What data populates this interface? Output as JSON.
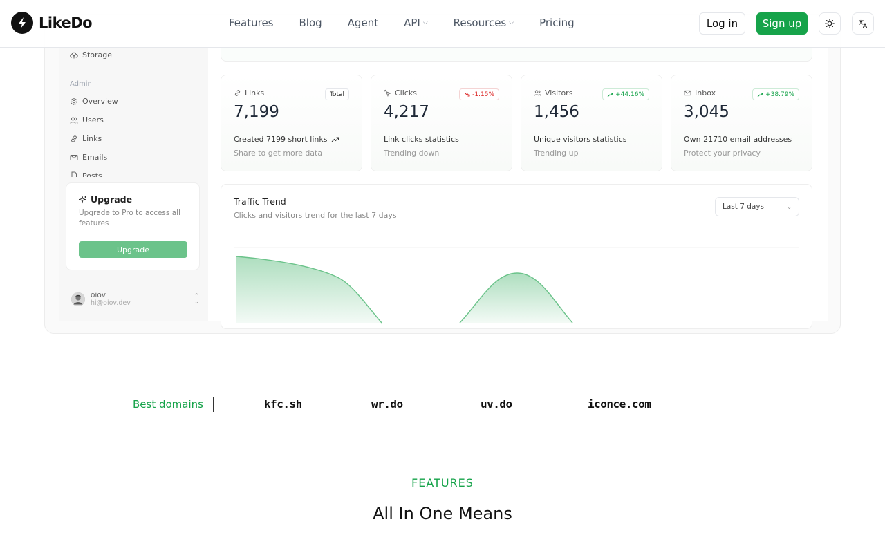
{
  "brand": {
    "name": "LikeDo"
  },
  "nav": {
    "items": [
      {
        "label": "Features",
        "dropdown": false
      },
      {
        "label": "Blog",
        "dropdown": false
      },
      {
        "label": "Agent",
        "dropdown": false
      },
      {
        "label": "API",
        "dropdown": true
      },
      {
        "label": "Resources",
        "dropdown": true
      },
      {
        "label": "Pricing",
        "dropdown": false
      }
    ],
    "login": "Log in",
    "signup": "Sign up"
  },
  "dashboard": {
    "sidebar": {
      "storage": "Storage",
      "admin_label": "Admin",
      "admin_items": [
        "Overview",
        "Users",
        "Links",
        "Emails",
        "Posts"
      ],
      "upgrade": {
        "title": "Upgrade",
        "desc": "Upgrade to Pro to access all features",
        "button": "Upgrade"
      },
      "user": {
        "name": "oiov",
        "email": "hi@oiov.dev"
      }
    },
    "stats": [
      {
        "label": "Links",
        "badge": "Total",
        "badge_type": "total",
        "value": "7,199",
        "desc": "Created 7199 short links",
        "sub": "Share to get more data",
        "icon": "link-icon"
      },
      {
        "label": "Clicks",
        "badge": "-1.15%",
        "badge_type": "down",
        "value": "4,217",
        "desc": "Link clicks statistics",
        "sub": "Trending down",
        "icon": "pointer-icon"
      },
      {
        "label": "Visitors",
        "badge": "+44.16%",
        "badge_type": "up",
        "value": "1,456",
        "desc": "Unique visitors statistics",
        "sub": "Trending up",
        "icon": "users-icon"
      },
      {
        "label": "Inbox",
        "badge": "+38.79%",
        "badge_type": "up",
        "value": "3,045",
        "desc": "Own 21710 email addresses",
        "sub": "Protect your privacy",
        "icon": "mail-icon"
      }
    ],
    "chart": {
      "title": "Traffic Trend",
      "subtitle": "Clicks and visitors trend for the last 7 days",
      "range_select": "Last 7 days"
    }
  },
  "domains": {
    "label": "Best domains",
    "items": [
      "kfc.sh",
      "wr.do",
      "uv.do",
      "iconce.com"
    ]
  },
  "features": {
    "kicker": "FEATURES",
    "title": "All In One Means"
  },
  "colors": {
    "accent": "#16a34a",
    "accent_soft": "#6bc38a",
    "down": "#dc2626"
  }
}
